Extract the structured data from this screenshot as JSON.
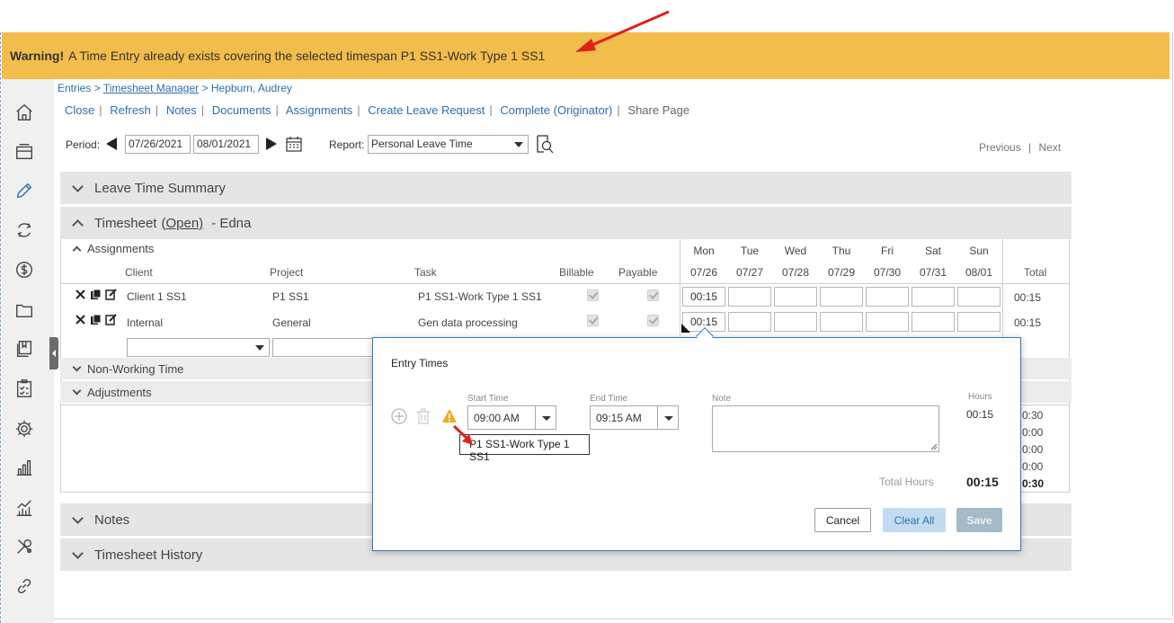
{
  "warning": {
    "prefix": "Warning!",
    "message": "A Time Entry already exists covering the selected timespan P1 SS1-Work Type 1 SS1"
  },
  "breadcrumb": {
    "entries": "Entries",
    "sep1": ">",
    "manager": "Timesheet Manager",
    "sep2": ">",
    "person": "Hepburn, Audrey"
  },
  "actions": [
    "Close",
    "Refresh",
    "Notes",
    "Documents",
    "Assignments",
    "Create Leave Request",
    "Complete (Originator)",
    "Share Page"
  ],
  "period": {
    "label": "Period:",
    "start": "07/26/2021",
    "end": "08/01/2021"
  },
  "report": {
    "label": "Report:",
    "value": "Personal Leave Time"
  },
  "pager": {
    "previous": "Previous",
    "sep": "|",
    "next": "Next"
  },
  "sections": {
    "leave_summary": "Leave Time Summary",
    "timesheet_label": "Timesheet",
    "timesheet_status": "(Open)",
    "timesheet_owner": "- Edna",
    "assignments": "Assignments",
    "non_working": "Non-Working Time",
    "adjustments": "Adjustments",
    "notes": "Notes",
    "history": "Timesheet History"
  },
  "columns": {
    "client": "Client",
    "project": "Project",
    "task": "Task",
    "billable": "Billable",
    "payable": "Payable",
    "total": "Total"
  },
  "days": [
    {
      "name": "Mon",
      "date": "07/26"
    },
    {
      "name": "Tue",
      "date": "07/27"
    },
    {
      "name": "Wed",
      "date": "07/28"
    },
    {
      "name": "Thu",
      "date": "07/29"
    },
    {
      "name": "Fri",
      "date": "07/30"
    },
    {
      "name": "Sat",
      "date": "07/31"
    },
    {
      "name": "Sun",
      "date": "08/01"
    }
  ],
  "rows": [
    {
      "client": "Client 1 SS1",
      "project": "P1 SS1",
      "task": "P1 SS1-Work Type 1 SS1",
      "billable": true,
      "payable": true,
      "mon": "00:15",
      "total": "00:15"
    },
    {
      "client": "Internal",
      "project": "General",
      "task": "Gen data processing",
      "billable": true,
      "payable": true,
      "mon": "00:15",
      "total": "00:15"
    }
  ],
  "right_totals": [
    "0:30",
    "0:00",
    "0:00",
    "0:00",
    "0:30"
  ],
  "popup": {
    "title": "Entry Times",
    "start_label": "Start Time",
    "start_value": "09:00 AM",
    "end_label": "End Time",
    "end_value": "09:15 AM",
    "note_label": "Note",
    "hours_label": "Hours",
    "hours_value": "00:15",
    "total_label": "Total Hours",
    "total_value": "00:15",
    "tooltip": "P1 SS1-Work Type 1 SS1",
    "cancel": "Cancel",
    "clear_all": "Clear All",
    "save": "Save"
  },
  "colors": {
    "warning_bg": "#f2bd4b",
    "link": "#2a6fb0",
    "popup_border": "#2d7bbf",
    "arrow": "#e0201c"
  },
  "rail_icons": [
    "home-icon",
    "inbox-icon",
    "pencil-icon",
    "sync-icon",
    "dollar-icon",
    "folder-icon",
    "book-icon",
    "checklist-icon",
    "gear-icon",
    "bar-chart-icon",
    "line-chart-icon",
    "tools-icon",
    "link-icon"
  ]
}
